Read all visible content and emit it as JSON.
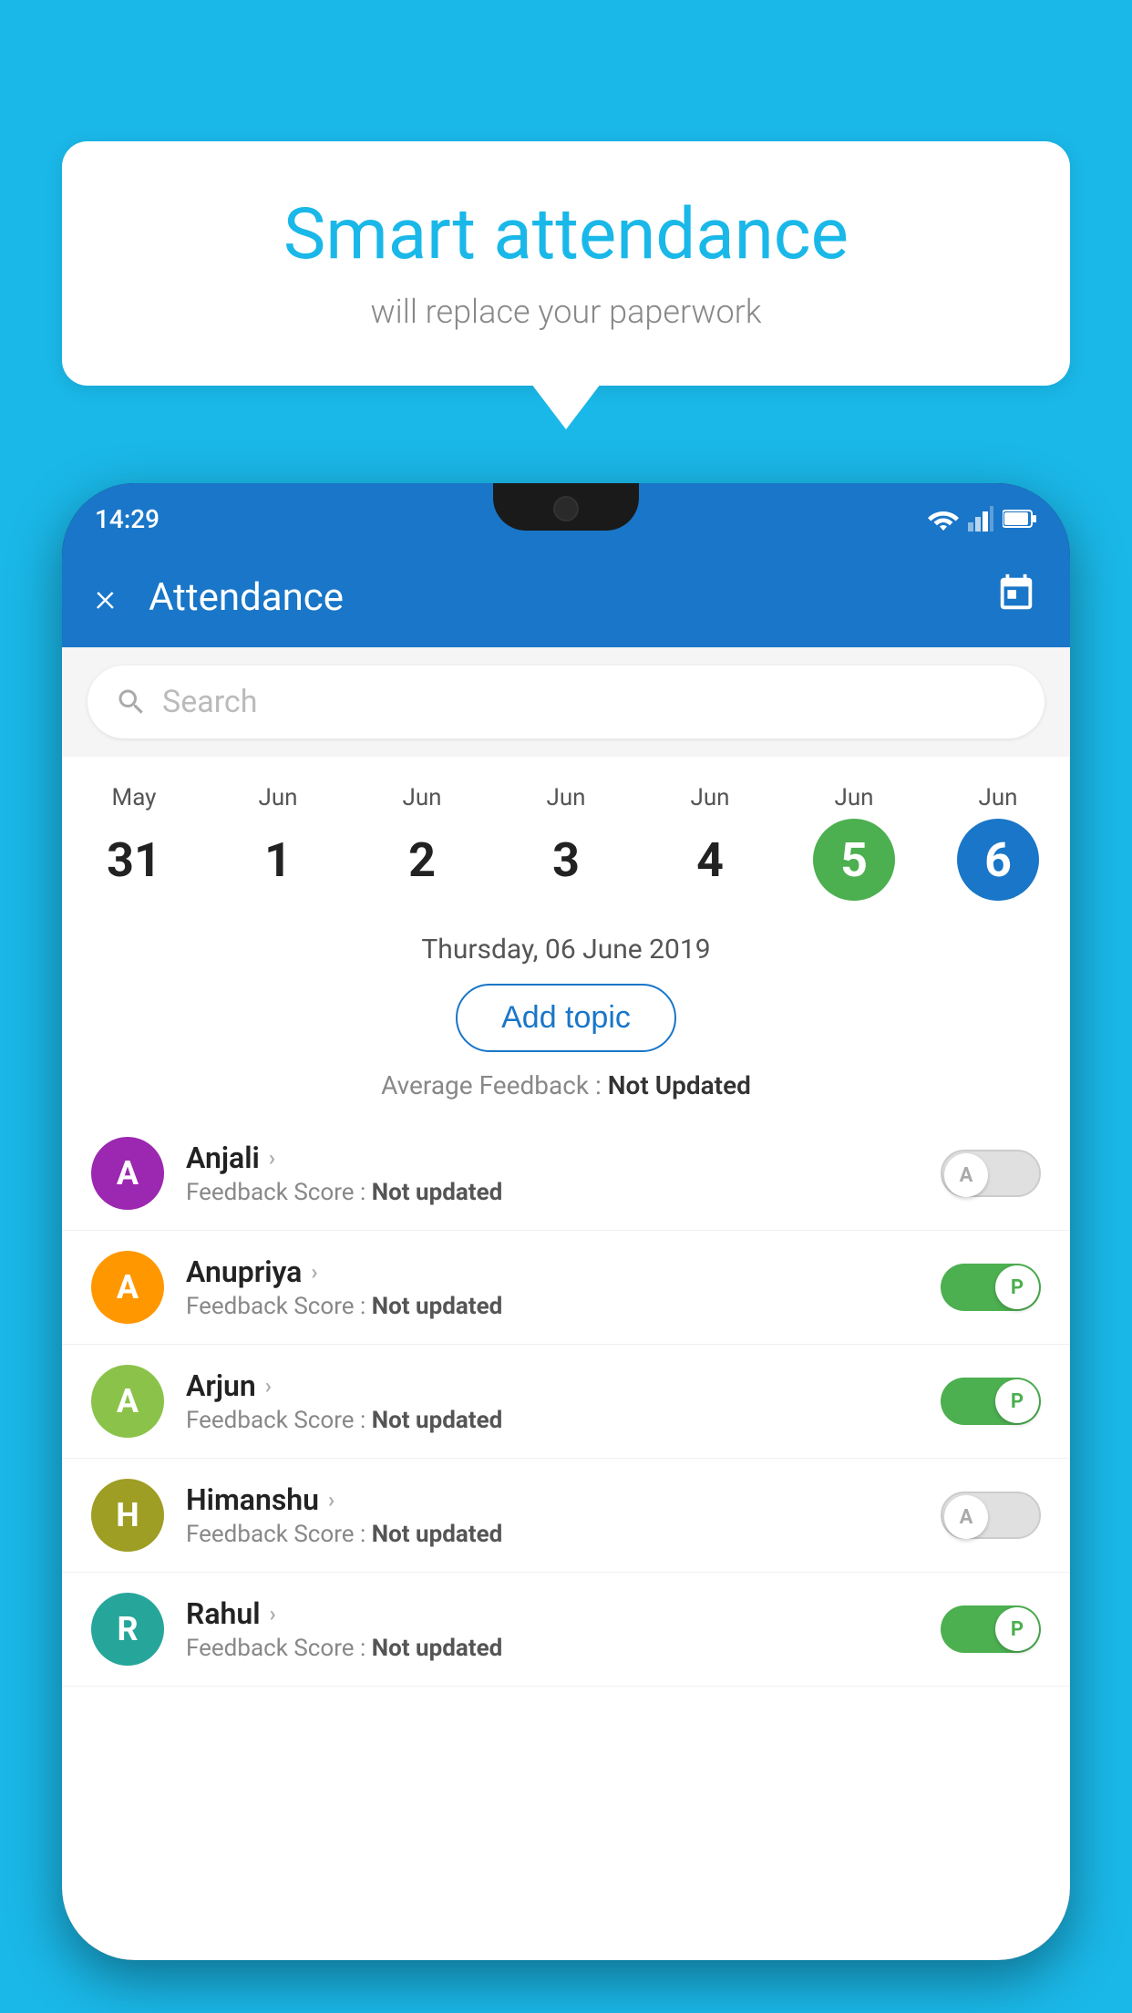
{
  "background_color": "#1ab8e8",
  "bubble": {
    "title": "Smart attendance",
    "subtitle": "will replace your paperwork"
  },
  "app_bar": {
    "title": "Attendance",
    "close_label": "×"
  },
  "search": {
    "placeholder": "Search"
  },
  "calendar": {
    "days": [
      {
        "month": "May",
        "date": "31",
        "state": "normal"
      },
      {
        "month": "Jun",
        "date": "1",
        "state": "normal"
      },
      {
        "month": "Jun",
        "date": "2",
        "state": "normal"
      },
      {
        "month": "Jun",
        "date": "3",
        "state": "normal"
      },
      {
        "month": "Jun",
        "date": "4",
        "state": "normal"
      },
      {
        "month": "Jun",
        "date": "5",
        "state": "today"
      },
      {
        "month": "Jun",
        "date": "6",
        "state": "selected"
      }
    ],
    "selected_date_label": "Thursday, 06 June 2019"
  },
  "add_topic_label": "Add topic",
  "average_feedback_label": "Average Feedback : ",
  "average_feedback_value": "Not Updated",
  "students": [
    {
      "name": "Anjali",
      "avatar_letter": "A",
      "avatar_color": "purple",
      "feedback_label": "Feedback Score : ",
      "feedback_value": "Not updated",
      "toggle_state": "off",
      "toggle_letter": "A"
    },
    {
      "name": "Anupriya",
      "avatar_letter": "A",
      "avatar_color": "orange",
      "feedback_label": "Feedback Score : ",
      "feedback_value": "Not updated",
      "toggle_state": "on",
      "toggle_letter": "P"
    },
    {
      "name": "Arjun",
      "avatar_letter": "A",
      "avatar_color": "green",
      "feedback_label": "Feedback Score : ",
      "feedback_value": "Not updated",
      "toggle_state": "on",
      "toggle_letter": "P"
    },
    {
      "name": "Himanshu",
      "avatar_letter": "H",
      "avatar_color": "olive",
      "feedback_label": "Feedback Score : ",
      "feedback_value": "Not updated",
      "toggle_state": "off",
      "toggle_letter": "A"
    },
    {
      "name": "Rahul",
      "avatar_letter": "R",
      "avatar_color": "teal",
      "feedback_label": "Feedback Score : ",
      "feedback_value": "Not updated",
      "toggle_state": "on",
      "toggle_letter": "P"
    }
  ],
  "status_bar": {
    "time": "14:29"
  }
}
